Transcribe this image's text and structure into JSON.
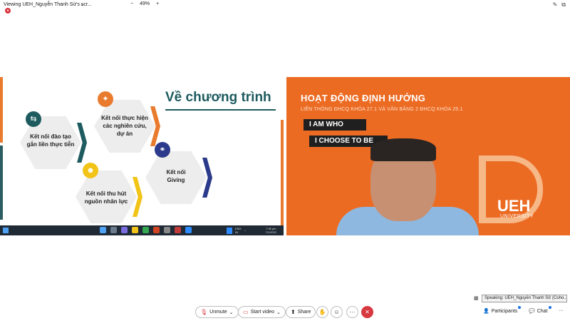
{
  "topbar": {
    "viewing": "Viewing UEH_Nguyễn Thanh Sử's scr...",
    "chevron": "⌄",
    "zoom_out": "−",
    "zoom_level": "49%",
    "zoom_in": "+"
  },
  "slide": {
    "title": "Về chương trình",
    "items": [
      {
        "label1": "Kết nối đào tạo",
        "label2": "gắn liền thực tiễn",
        "icon": "connect-icon",
        "color": "#1e5b5f"
      },
      {
        "label1": "Kết nối thực hiện",
        "label2": "các nghiên cứu,",
        "label3": "dự án",
        "icon": "lightbulb-icon",
        "color": "#e97b2e"
      },
      {
        "label1": "Kết nối",
        "label2": "Giving",
        "icon": "link-icon",
        "color": "#2b3a8a"
      },
      {
        "label1": "Kết nối thu hút",
        "label2": "nguồn nhân lực",
        "icon": "people-icon",
        "color": "#f2c418"
      }
    ]
  },
  "taskbar": {
    "lang1": "ENG",
    "lang2": "IN",
    "time": "7:35 pm",
    "date": "7/1/2022"
  },
  "video": {
    "title": "HOẠT ĐỘNG ĐỊNH HƯỚNG",
    "subtitle": "LIÊN THÔNG ĐHCQ KHÓA 27.1 VÀ VĂN BẰNG 2 ĐHCQ KHÓA 25.1",
    "band1": "I AM WHO",
    "band2": "I CHOOSE TO BE",
    "logo": "UEH",
    "logo_sub": "UNIVERSITY"
  },
  "speaking": "Speaking: UEH_Nguyễn Thanh Sử (Coho...",
  "controls": {
    "unmute": "Unmute",
    "start_video": "Start video",
    "share": "Share",
    "more": "···",
    "end": "✕",
    "participants": "Participants",
    "chat": "Chat",
    "overflow": "···"
  },
  "colors": {
    "accent_orange": "#e97b2e",
    "teal": "#1e5b5f",
    "end_red": "#d7373f"
  }
}
